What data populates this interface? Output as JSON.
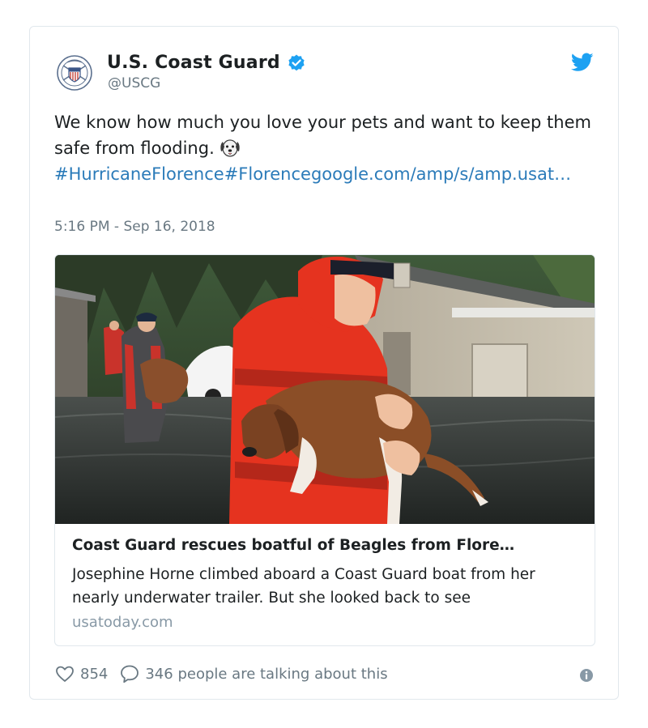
{
  "author": {
    "name": "U.S. Coast Guard",
    "handle": "@USCG",
    "verified": true,
    "avatar_icon": "coast-guard-seal-icon"
  },
  "tweet": {
    "text_line1": "We know how much you love your pets and want to keep them safe from flooding.",
    "emoji": "dog-face-icon",
    "hashtag1": "#HurricaneFlorence",
    "hashtag2": "#Florence",
    "link": "google.com/amp/s/amp.usat…",
    "timestamp": "5:16 PM - Sep 16, 2018"
  },
  "card": {
    "title": "Coast Guard rescues boatful of Beagles from Flore…",
    "description": "Josephine Horne climbed aboard a Coast Guard boat from her nearly underwater trailer. But she looked back to see",
    "domain": "usatoday.com"
  },
  "actions": {
    "likes": "854",
    "replies_text": "346 people are talking about this"
  },
  "colors": {
    "link": "#2b7bb9",
    "secondary_text": "#697882",
    "twitter_blue": "#1da1f2",
    "verified_blue": "#1da1f2",
    "border": "#e1e8ed"
  }
}
